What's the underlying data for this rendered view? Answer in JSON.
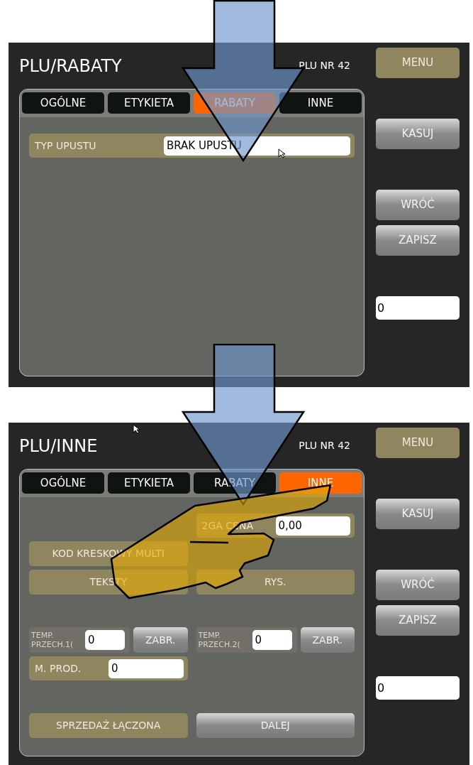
{
  "screens": [
    {
      "title": "PLU/RABATY",
      "plu_number": "PLU NR 42",
      "tabs": [
        {
          "label": "OGÓLNE",
          "selected": false
        },
        {
          "label": "ETYKIETA",
          "selected": false
        },
        {
          "label": "RABATY",
          "selected": true
        },
        {
          "label": "INNE",
          "selected": false
        }
      ],
      "sections": [
        [
          {
            "full": {
              "kind": "field",
              "label": "TYP UPUSTU",
              "value": "BRAK UPUSTU"
            }
          }
        ]
      ],
      "side_groups": [
        [
          {
            "kind": "gold",
            "label": "MENU"
          }
        ],
        [
          {
            "kind": "gray",
            "label": "KASUJ"
          }
        ],
        [
          {
            "kind": "gray",
            "label": "WRÓĆ"
          },
          {
            "kind": "gray",
            "label": "ZAPISZ"
          }
        ],
        [
          {
            "kind": "field",
            "value": "0"
          }
        ]
      ]
    },
    {
      "title": "PLU/INNE",
      "plu_number": "PLU NR 42",
      "tabs": [
        {
          "label": "OGÓLNE",
          "selected": false
        },
        {
          "label": "ETYKIETA",
          "selected": false
        },
        {
          "label": "RABATY",
          "selected": false
        },
        {
          "label": "INNE",
          "selected": true
        }
      ],
      "sections": [
        [
          {
            "right": {
              "kind": "field",
              "label": "2GA CENA",
              "value": "0,00"
            }
          },
          {
            "left": {
              "kind": "gold",
              "label": "KOD KRESKOWY MULTI"
            }
          },
          {
            "left": {
              "kind": "gold",
              "label": "TEKSTY"
            },
            "right": {
              "kind": "gold",
              "label": "RYS."
            }
          }
        ],
        [
          {
            "left": {
              "kind": "temp",
              "label": "TEMP. PRZECH.1(",
              "value": "0",
              "button": "ZABR."
            },
            "right": {
              "kind": "temp",
              "label": "TEMP. PRZECH.2(",
              "value": "0",
              "button": "ZABR."
            }
          },
          {
            "left": {
              "kind": "field",
              "label": "M. PROD.",
              "value": "0"
            }
          }
        ],
        [
          {
            "left": {
              "kind": "gold",
              "label": "SPRZEDAŻ ŁĄCZONA"
            },
            "right": {
              "kind": "gray",
              "label": "DALEJ"
            }
          }
        ]
      ],
      "side_groups": [
        [
          {
            "kind": "gold",
            "label": "MENU"
          }
        ],
        [
          {
            "kind": "gray",
            "label": "KASUJ"
          }
        ],
        [
          {
            "kind": "gray",
            "label": "WRÓĆ"
          },
          {
            "kind": "gray",
            "label": "ZAPISZ"
          }
        ],
        [
          {
            "kind": "field",
            "value": "0"
          }
        ]
      ]
    }
  ]
}
